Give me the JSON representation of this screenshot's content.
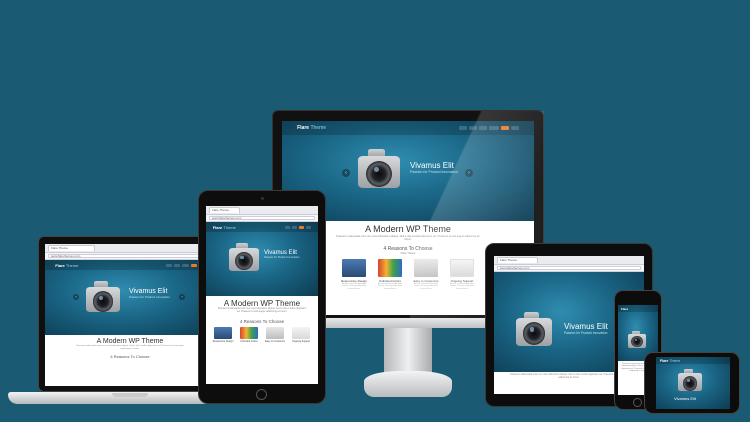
{
  "site": {
    "logo": "Flare",
    "logo_sub": "Theme",
    "url": "www.flarethemes.com",
    "tab_title": "Flare Theme",
    "hero_title": "Vivamus Elit",
    "hero_subtitle": "Passion for Product Innovation",
    "section_title": "A Modern WP Theme",
    "section_text": "Praesent malesuada enim nec nunc bibendum aliquet. Sed a nisl et tellus dignissim vel. Praesent et erat augue adipiscing ac lorem.",
    "reasons_title": "4 Reasons To Choose",
    "reasons_sub": "Flare Theme",
    "features": [
      {
        "label": "Responsive Design",
        "desc": "Aenean euismod bibendum laoreet. Proin gravida dolor sit amet lacus."
      },
      {
        "label": "Unlimited Colors",
        "desc": "Aenean euismod bibendum laoreet. Proin gravida dolor sit amet lacus."
      },
      {
        "label": "Easy to Customize",
        "desc": "Aenean euismod bibendum laoreet. Proin gravida dolor sit amet lacus."
      },
      {
        "label": "Ongoing Support",
        "desc": "Aenean euismod bibendum laoreet. Proin gravida dolor sit amet lacus."
      }
    ]
  },
  "colors": {
    "background": "#1a5a72",
    "accent": "#e9792b",
    "hero_dark": "#0d3b52",
    "hero_light": "#2f8db0"
  }
}
